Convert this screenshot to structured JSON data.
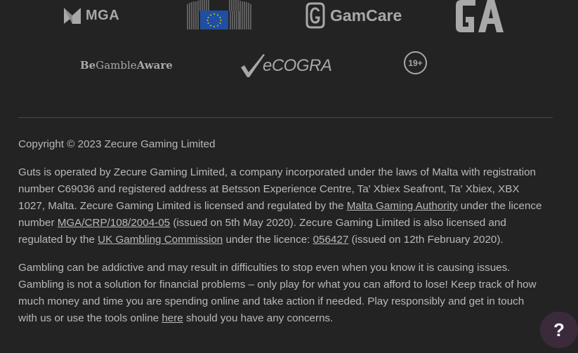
{
  "logos": {
    "mga": "MGA",
    "gamcare": "GamCare",
    "ga": "GA",
    "bga_be": "Be",
    "bga_gamble": "Gamble",
    "bga_aware": "Aware",
    "ecogra": "eCOGRA",
    "age": "19+"
  },
  "footer": {
    "copyright": "Copyright © 2023 Zecure Gaming Limited",
    "p1_a": "Guts is operated by Zecure Gaming Limited, a company incorporated under the laws of Malta with registration number C69036 and registered address at Betsson Experience Centre, Ta' Xbiex Seafront, Ta' Xbiex, XBX 1027, Malta. Zecure Gaming Limited is licensed and regulated by the ",
    "mga_link": "Malta Gaming Authority",
    "p1_b": " under the licence number ",
    "mga_licence_link": "MGA/CRP/108/2004-05",
    "p1_c": " (issued on 5th May 2020). Zecure Gaming Limited is also licensed and regulated by the ",
    "ukgc_link": "UK Gambling Commission",
    "p1_d": " under the licence: ",
    "ukgc_licence_link": "056427",
    "p1_e": " (issued on 12th February 2020).",
    "p2_a": "Gambling can be addictive and may result in difficulties to stop even when you know it is causing issues. Gambling is not a solution for financial problems – only play for what you can afford to lose! Keep track of how much money and time you are spending online and take action if needed. Play responsibly and get in touch with us or use the tools online ",
    "here_link": "here",
    "p2_b": " should you have any concerns."
  },
  "help": {
    "label": "?"
  }
}
